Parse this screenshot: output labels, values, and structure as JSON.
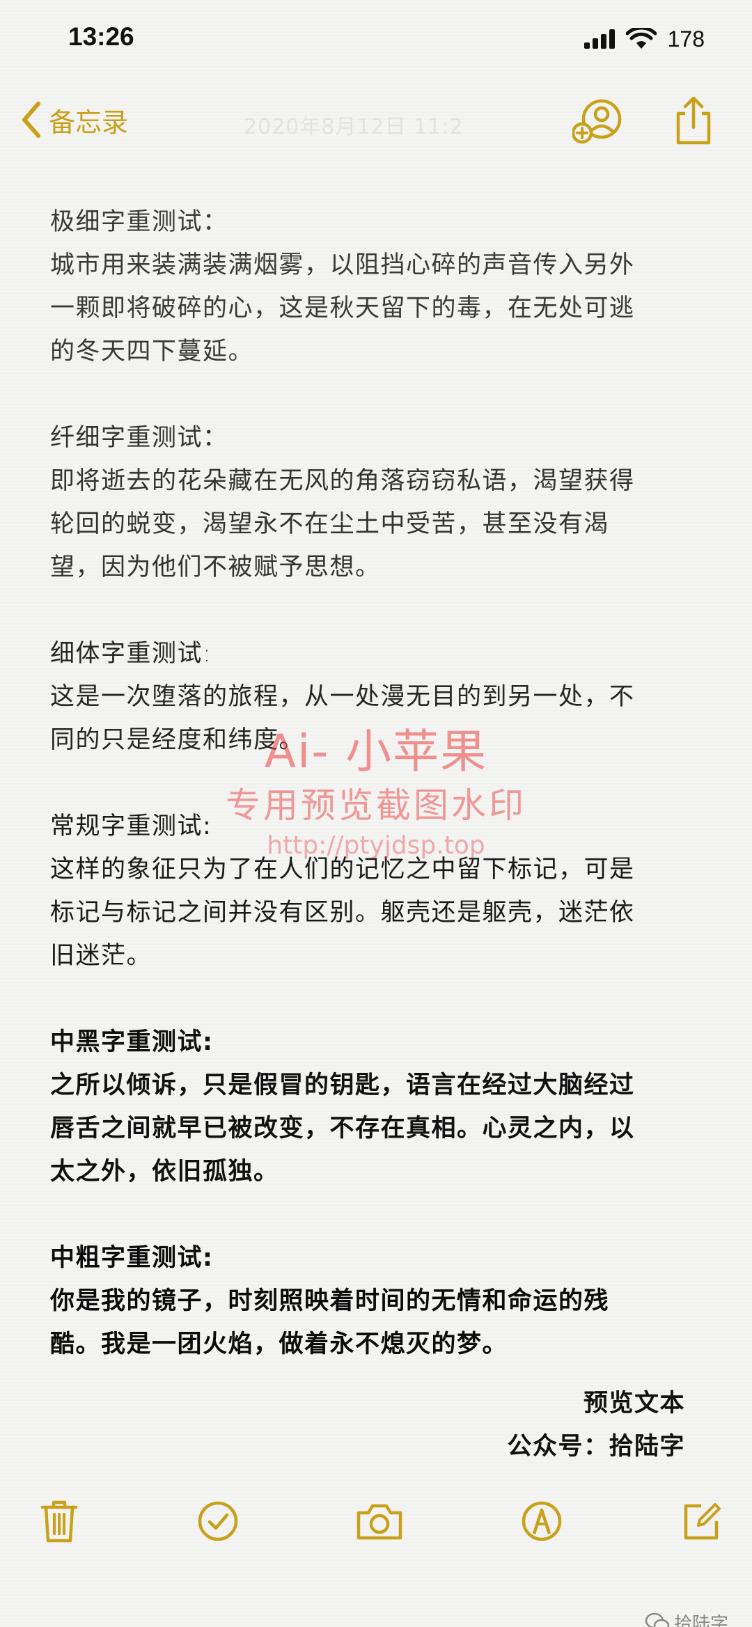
{
  "status_bar": {
    "time": "13:26",
    "battery": "178"
  },
  "nav": {
    "back_label": "备忘录",
    "date": "2020年8月12日 11:2",
    "accent_color": "#c8a01a",
    "collab_icon": "add-person-icon",
    "share_icon": "share-icon"
  },
  "note": {
    "sections": [
      {
        "title": "极细字重测试：",
        "lines": [
          "城市用来装满装满烟雾，以阻挡心碎的声音传入另外",
          "一颗即将破碎的心，这是秋天留下的毒，在无处可逃",
          "的冬天四下蔓延。"
        ]
      },
      {
        "title": "纤细字重测试：",
        "lines": [
          "即将逝去的花朵藏在无风的角落窃窃私语，渴望获得",
          "轮回的蜕变，渴望永不在尘土中受苦，甚至没有渴",
          "望，因为他们不被赋予思想。"
        ]
      },
      {
        "title": "细体字重测试:",
        "lines": [
          "这是一次堕落的旅程，从一处漫无目的到另一处，不",
          "同的只是经度和纬度。"
        ]
      },
      {
        "title": "常规字重测试:",
        "lines": [
          "这样的象征只为了在人们的记忆之中留下标记，可是",
          "标记与标记之间并没有区别。躯壳还是躯壳，迷茫依",
          "旧迷茫。"
        ]
      },
      {
        "title": "中黑字重测试:",
        "lines": [
          "之所以倾诉，只是假冒的钥匙，语言在经过大脑经过",
          "唇舌之间就早已被改变，不存在真相。心灵之内，以",
          "太之外，依旧孤独。"
        ]
      },
      {
        "title": "中粗字重测试:",
        "lines": [
          "你是我的镜子，时刻照映着时间的无情和命运的残",
          "酷。我是一团火焰，做着永不熄灭的梦。"
        ]
      }
    ],
    "signature": [
      "预览文本",
      "公众号：拾陆字"
    ]
  },
  "watermark": {
    "line1": "Ai- 小苹果",
    "line2": "专用预览截图水印",
    "line3": "http://ptyjdsp.top",
    "color": "#eb3c3c"
  },
  "toolbar": {
    "items": [
      "trash-icon",
      "checklist-icon",
      "camera-icon",
      "markup-icon",
      "compose-icon"
    ]
  },
  "footer": {
    "credit": "拾陆字"
  }
}
